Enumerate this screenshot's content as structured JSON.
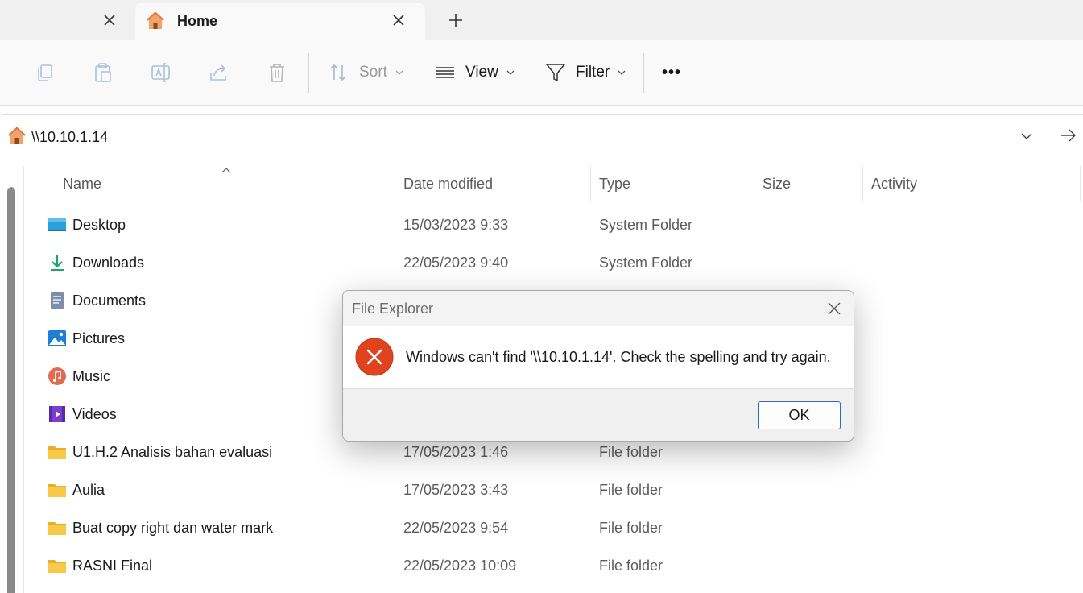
{
  "tabs": {
    "active_title": "Home",
    "new_tab_label": "+"
  },
  "toolbar": {
    "sort_label": "Sort",
    "view_label": "View",
    "filter_label": "Filter",
    "more_label": "•••"
  },
  "address_bar": {
    "path": "\\\\10.10.1.14"
  },
  "columns": [
    "Name",
    "Date modified",
    "Type",
    "Size",
    "Activity"
  ],
  "files": [
    {
      "name": "Desktop",
      "date": "15/03/2023 9:33",
      "type": "System Folder",
      "icon": "desktop-icon"
    },
    {
      "name": "Downloads",
      "date": "22/05/2023 9:40",
      "type": "System Folder",
      "icon": "downloads-icon"
    },
    {
      "name": "Documents",
      "date": "",
      "type": "",
      "icon": "documents-icon"
    },
    {
      "name": "Pictures",
      "date": "",
      "type": "",
      "icon": "pictures-icon"
    },
    {
      "name": "Music",
      "date": "",
      "type": "",
      "icon": "music-icon"
    },
    {
      "name": "Videos",
      "date": "",
      "type": "",
      "icon": "videos-icon"
    },
    {
      "name": "U1.H.2 Analisis bahan evaluasi",
      "date": "17/05/2023 1:46",
      "type": "File folder",
      "icon": "folder-icon"
    },
    {
      "name": "Aulia",
      "date": "17/05/2023 3:43",
      "type": "File folder",
      "icon": "folder-icon"
    },
    {
      "name": "Buat copy right dan water mark",
      "date": "22/05/2023 9:54",
      "type": "File folder",
      "icon": "folder-icon"
    },
    {
      "name": "RASNI Final",
      "date": "22/05/2023 10:09",
      "type": "File folder",
      "icon": "folder-icon"
    }
  ],
  "dialog": {
    "title": "File Explorer",
    "message": "Windows can't find '\\\\10.10.1.14'. Check the spelling and try again.",
    "ok_label": "OK"
  },
  "colors": {
    "accent_blue": "#2a6bbf",
    "error_red": "#e0441f",
    "folder_yellow": "#f7c948",
    "home_orange": "#e8743b"
  }
}
